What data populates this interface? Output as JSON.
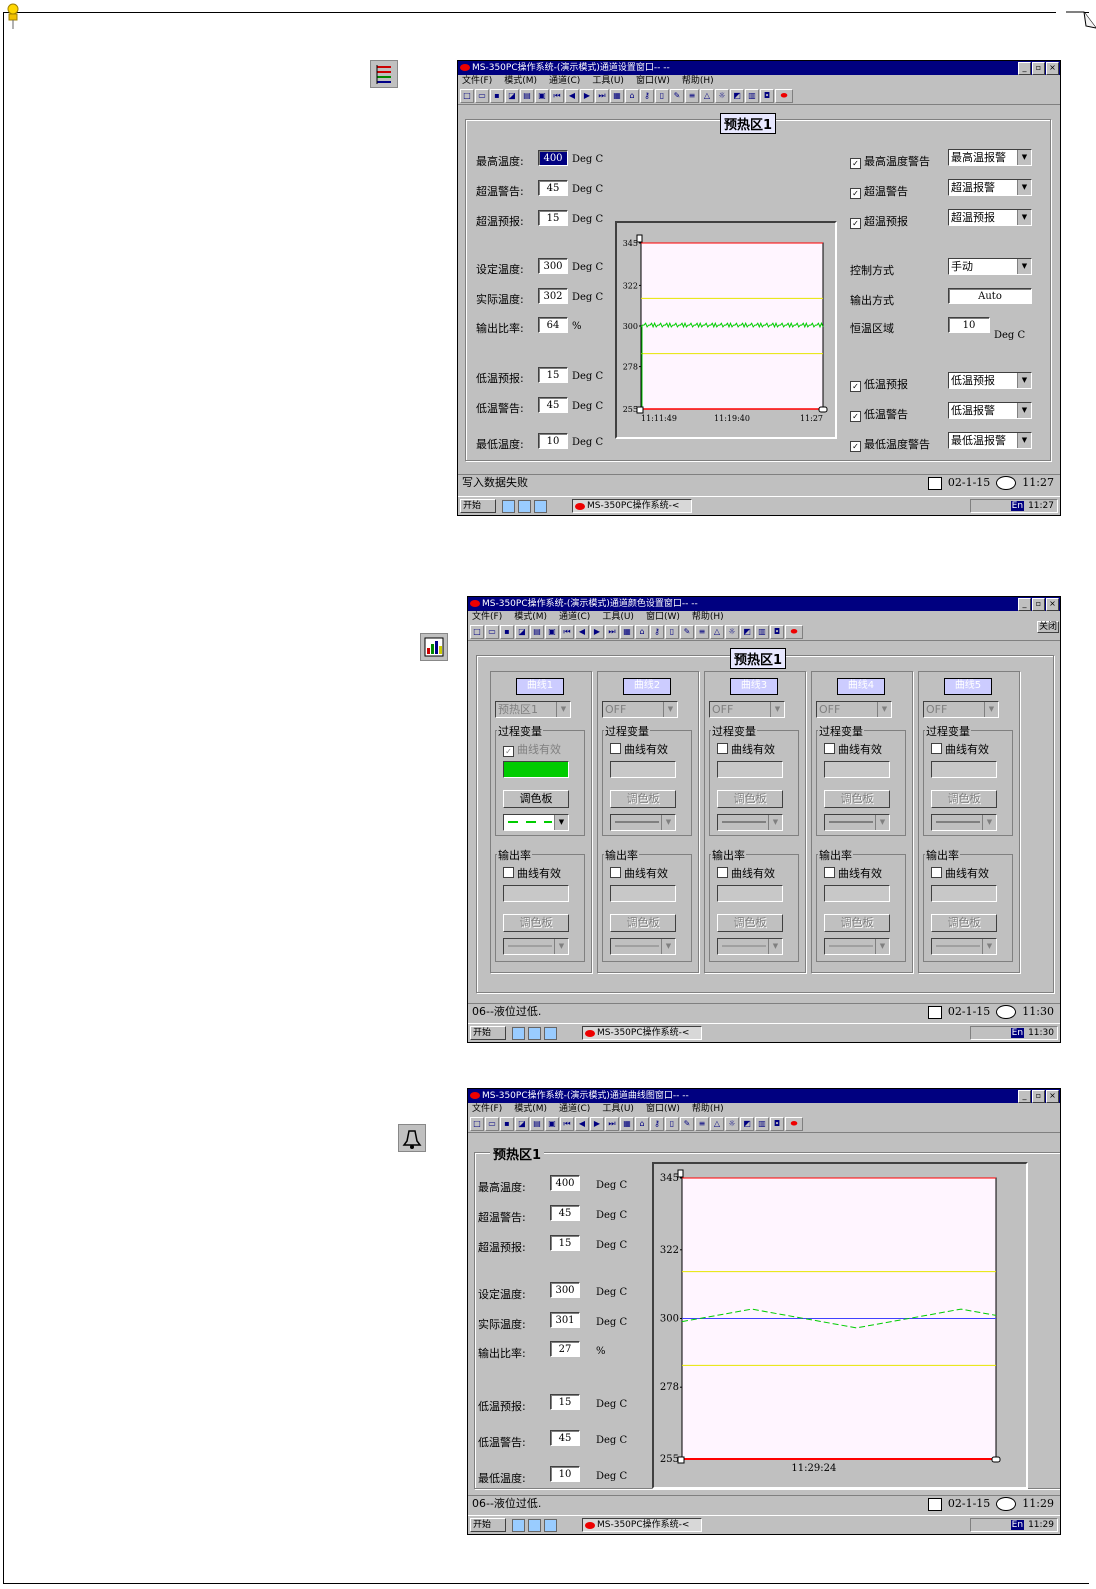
{
  "colors": {
    "accent": "#000080",
    "alarm_line": "#ff0000",
    "warn_line": "#e6e600",
    "curve_green": "#00cc00",
    "plot_bg": "#fff5ff",
    "set_line": "#4040ff"
  },
  "app": {
    "title_settings": "MS-350PC操作系统-(演示模式)通道设置窗口-- --",
    "title_color": "MS-350PC操作系统-(演示模式)通道颜色设置窗口-- --",
    "title_graph": "MS-350PC操作系统-(演示模式)通道曲线图窗口-- --",
    "menus": [
      "文件(F)",
      "模式(M)",
      "通道(C)",
      "工具(U)",
      "窗口(W)",
      "帮助(H)"
    ],
    "zone": "预热区1",
    "close_label": "关闭",
    "start_label": "开始",
    "task_label": "MS-350PC操作系统-<",
    "tray_lang": "En"
  },
  "window1": {
    "labels": {
      "max_temp": "最高温度:",
      "over_alarm": "超温警告:",
      "over_pre": "超温预报:",
      "set_temp": "设定温度:",
      "actual_temp": "实际温度:",
      "output": "输出比率:",
      "low_pre": "低温预报:",
      "low_alarm": "低温警告:",
      "min_temp": "最低温度:"
    },
    "values": {
      "max_temp": "400",
      "over_alarm": "45",
      "over_pre": "15",
      "set_temp": "300",
      "actual_temp": "302",
      "output": "64",
      "low_pre": "15",
      "low_alarm": "45",
      "min_temp": "10"
    },
    "unit": "Deg C",
    "pct": "%",
    "right_checks": {
      "max_alarm": "最高温度警告",
      "over_alarm": "超温警告",
      "over_pre": "超温预报",
      "low_pre": "低温预报",
      "low_alarm": "低温警告",
      "min_alarm": "最低温度警告"
    },
    "right_combos": {
      "max_alarm": "最高温报警",
      "over_alarm": "超温报警",
      "over_pre": "超温预报",
      "low_pre": "低温预报",
      "low_alarm": "低温报警",
      "min_alarm": "最低温报警"
    },
    "control_mode_label": "控制方式",
    "control_mode": "手动",
    "output_mode_label": "输出方式",
    "output_mode": "Auto",
    "const_zone_label": "恒温区域",
    "const_zone": "10",
    "status": "写入数据失败",
    "date": "02-1-15",
    "time": "11:27",
    "tray_time": "11:27",
    "chart_data": {
      "type": "line",
      "y_ticks": [
        "345",
        "322",
        "300",
        "278",
        "255"
      ],
      "x_ticks": [
        "11:11:49",
        "11:19:40",
        "11:27"
      ],
      "ylim": [
        255,
        345
      ],
      "series": [
        {
          "values": [
            301,
            299,
            302,
            300,
            301,
            299,
            302,
            300,
            301,
            300
          ]
        }
      ],
      "reference_lines": [
        345,
        315,
        285,
        255
      ]
    }
  },
  "window2": {
    "curves": [
      "曲线1",
      "曲线2",
      "曲线3",
      "曲线4",
      "曲线5"
    ],
    "channels": [
      "预热区1",
      "OFF",
      "OFF",
      "OFF",
      "OFF"
    ],
    "process_var": "过程变量",
    "output_rate": "输出率",
    "curve_valid": "曲线有效",
    "palette": "调色板",
    "status": "06--液位过低.",
    "date": "02-1-15",
    "time": "11:30",
    "tray_time": "11:30"
  },
  "window3": {
    "labels": {
      "max_temp": "最高温度:",
      "over_alarm": "超温警告:",
      "over_pre": "超温预报:",
      "set_temp": "设定温度:",
      "actual_temp": "实际温度:",
      "output": "输出比率:",
      "low_pre": "低温预报:",
      "low_alarm": "低温警告:",
      "min_temp": "最低温度:"
    },
    "values": {
      "max_temp": "400",
      "over_alarm": "45",
      "over_pre": "15",
      "set_temp": "300",
      "actual_temp": "301",
      "output": "27",
      "low_pre": "15",
      "low_alarm": "45",
      "min_temp": "10"
    },
    "unit": "Deg C",
    "pct": "%",
    "status": "06--液位过低.",
    "date": "02-1-15",
    "time": "11:29",
    "tray_time": "11:29",
    "chart_data": {
      "type": "line",
      "y_ticks": [
        "345",
        "322",
        "300",
        "278",
        "255"
      ],
      "x_ticks": [
        "11:29:24"
      ],
      "ylim": [
        255,
        345
      ],
      "series": [
        {
          "values": [
            299,
            301,
            303,
            301,
            299,
            297,
            299,
            301,
            303,
            301
          ]
        }
      ],
      "reference_lines": [
        345,
        315,
        285,
        255
      ]
    }
  }
}
